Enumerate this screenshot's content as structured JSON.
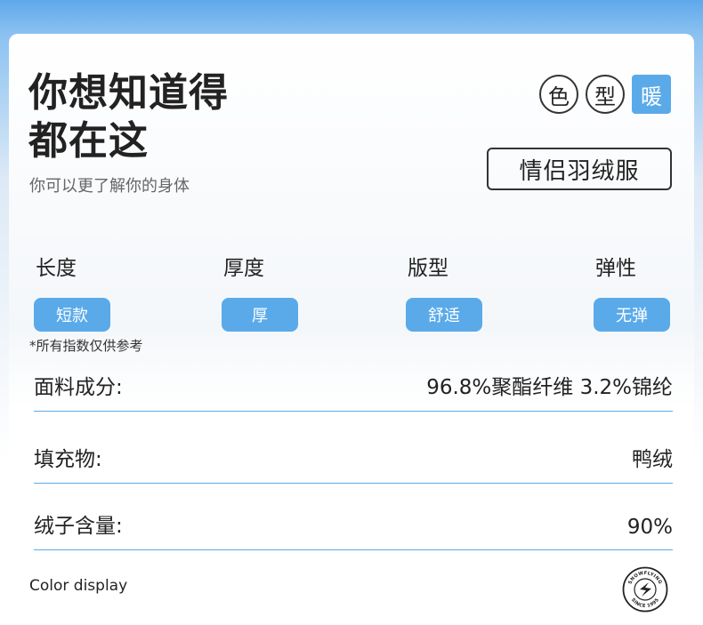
{
  "header": {
    "title_line1": "你想知道得",
    "title_line2": "都在这",
    "subtitle": "你可以更了解你的身体"
  },
  "tags": [
    {
      "label": "色",
      "active": false
    },
    {
      "label": "型",
      "active": false
    },
    {
      "label": "暖",
      "active": true
    }
  ],
  "product_name": "情侣羽绒服",
  "params": [
    {
      "label": "长度",
      "value": "短款"
    },
    {
      "label": "厚度",
      "value": "厚"
    },
    {
      "label": "版型",
      "value": "舒适"
    },
    {
      "label": "弹性",
      "value": "无弹"
    }
  ],
  "note": "*所有指数仅供参考",
  "specs": [
    {
      "label": "面料成分:",
      "value": "96.8%聚酯纤维 3.2%锦纶"
    },
    {
      "label": "填充物:",
      "value": "鸭绒"
    },
    {
      "label": "绒子含量:",
      "value": "90%"
    }
  ],
  "footer": {
    "color_display": "Color display",
    "logo_text_top": "SNOWFLYING",
    "logo_text_bottom": "SINCE 1995"
  },
  "colors": {
    "accent": "#5aaaea",
    "header_blue": "#5fa8ec"
  }
}
